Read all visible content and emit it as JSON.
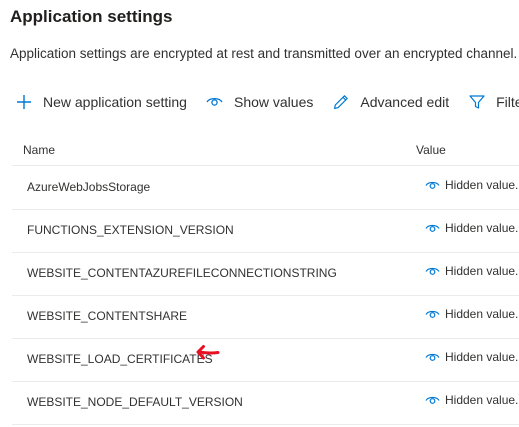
{
  "section": {
    "title": "Application settings",
    "description": "Application settings are encrypted at rest and transmitted over an encrypted channel."
  },
  "toolbar": {
    "new_label": "New application setting",
    "show_values_label": "Show values",
    "advanced_edit_label": "Advanced edit",
    "filter_label": "Filter"
  },
  "table": {
    "headers": {
      "name": "Name",
      "value": "Value"
    },
    "rows": [
      {
        "name": "AzureWebJobsStorage",
        "value": "Hidden value."
      },
      {
        "name": "FUNCTIONS_EXTENSION_VERSION",
        "value": "Hidden value."
      },
      {
        "name": "WEBSITE_CONTENTAZUREFILECONNECTIONSTRING",
        "value": "Hidden value."
      },
      {
        "name": "WEBSITE_CONTENTSHARE",
        "value": "Hidden value."
      },
      {
        "name": "WEBSITE_LOAD_CERTIFICATES",
        "value": "Hidden value."
      },
      {
        "name": "WEBSITE_NODE_DEFAULT_VERSION",
        "value": "Hidden value."
      }
    ]
  },
  "icons": {
    "add": "plus-icon",
    "show": "eye-icon",
    "edit": "pencil-icon",
    "filter": "filter-icon",
    "annotation": "red-arrow-icon"
  },
  "colors": {
    "accent": "#0078d4",
    "annotation": "#e81123",
    "divider": "#edebe9",
    "text": "#323130"
  }
}
